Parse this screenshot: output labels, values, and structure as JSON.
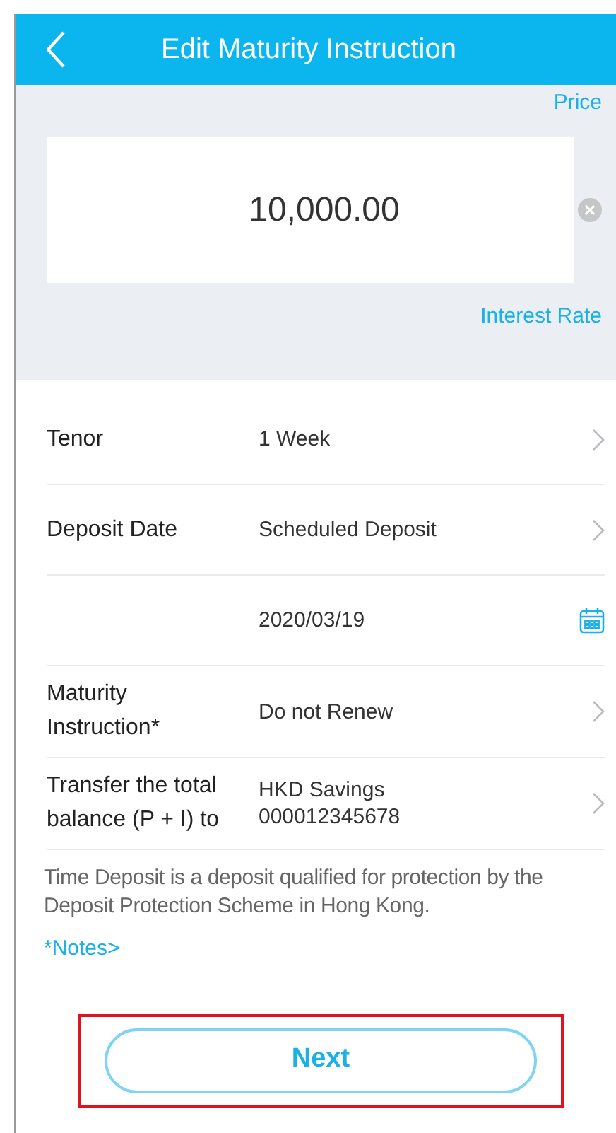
{
  "header": {
    "title": "Edit Maturity Instruction"
  },
  "amount": {
    "exchange_label": "Price",
    "value": "10,000.00",
    "interest_label": "Interest Rate"
  },
  "rows": [
    {
      "kind": "select",
      "label": "Tenor",
      "value": "1 Week"
    },
    {
      "kind": "select",
      "label": "Deposit Date",
      "value": "Scheduled Deposit"
    },
    {
      "kind": "date",
      "value": "2020/03/19"
    },
    {
      "kind": "select",
      "label": "Maturity Instruction*",
      "value": "Do not Renew"
    },
    {
      "kind": "select",
      "label": "Transfer the total balance (P + I) to",
      "value": "HKD Savings",
      "subvalue": "000012345678"
    }
  ],
  "disclaimer": "Time Deposit is a deposit qualified for protection by the Deposit Protection Scheme in Hong Kong.",
  "notes_link": "*Notes>",
  "next_button": {
    "label": "Next",
    "highlighted": true
  }
}
